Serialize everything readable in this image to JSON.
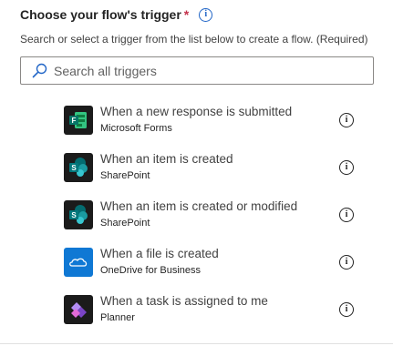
{
  "header": {
    "title": "Choose your flow's trigger",
    "required_marker": "*",
    "info_glyph": "i"
  },
  "subtitle": "Search or select a trigger from the list below to create a flow. (Required)",
  "search": {
    "placeholder": "Search all triggers",
    "value": "",
    "icon": "search-icon"
  },
  "triggers": [
    {
      "name": "When a new response is submitted",
      "connector": "Microsoft Forms",
      "icon": "microsoft-forms-icon",
      "info_glyph": "i"
    },
    {
      "name": "When an item is created",
      "connector": "SharePoint",
      "icon": "sharepoint-icon",
      "info_glyph": "i"
    },
    {
      "name": "When an item is created or modified",
      "connector": "SharePoint",
      "icon": "sharepoint-icon",
      "info_glyph": "i"
    },
    {
      "name": "When a file is created",
      "connector": "OneDrive for Business",
      "icon": "onedrive-icon",
      "info_glyph": "i"
    },
    {
      "name": "When a task is assigned to me",
      "connector": "Planner",
      "icon": "planner-icon",
      "info_glyph": "i"
    }
  ],
  "colors": {
    "accent": "#2266c7",
    "required": "#c4314b",
    "forms": "#077568",
    "sharepoint": "#036c70",
    "onedrive": "#0f78d4",
    "planner": "#7a44c6"
  }
}
